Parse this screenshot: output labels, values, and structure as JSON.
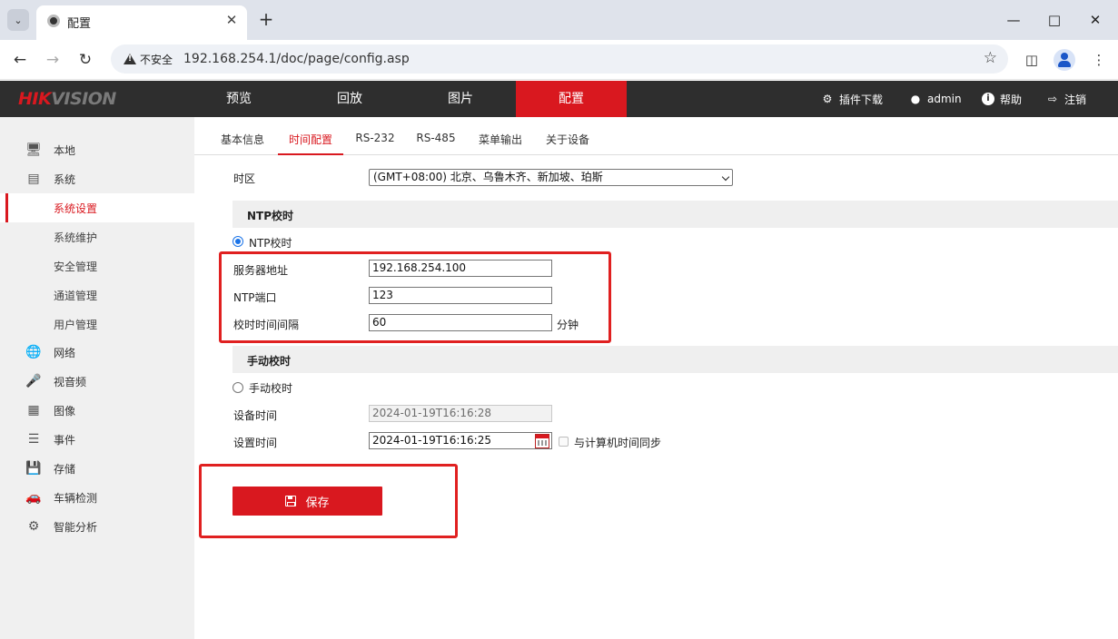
{
  "browser": {
    "tab_title": "配置",
    "security_label": "不安全",
    "url": "192.168.254.1/doc/page/config.asp"
  },
  "header": {
    "logo_hik": "HIK",
    "logo_vision": "VISION",
    "nav": [
      "预览",
      "回放",
      "图片",
      "配置"
    ],
    "active_nav": "配置",
    "plugin_download": "插件下载",
    "user": "admin",
    "help": "帮助",
    "logout": "注销"
  },
  "sidebar": {
    "items": [
      {
        "label": "本地",
        "icon": "monitor-icon"
      },
      {
        "label": "系统",
        "icon": "system-icon"
      },
      {
        "label": "系统设置",
        "sub": true,
        "active": true
      },
      {
        "label": "系统维护",
        "sub": true
      },
      {
        "label": "安全管理",
        "sub": true
      },
      {
        "label": "通道管理",
        "sub": true
      },
      {
        "label": "用户管理",
        "sub": true
      },
      {
        "label": "网络",
        "icon": "globe-icon"
      },
      {
        "label": "视音频",
        "icon": "mic-icon"
      },
      {
        "label": "图像",
        "icon": "image-icon"
      },
      {
        "label": "事件",
        "icon": "event-icon"
      },
      {
        "label": "存储",
        "icon": "storage-icon"
      },
      {
        "label": "车辆检测",
        "icon": "car-icon"
      },
      {
        "label": "智能分析",
        "icon": "analysis-icon"
      }
    ]
  },
  "subtabs": [
    "基本信息",
    "时间配置",
    "RS-232",
    "RS-485",
    "菜单输出",
    "关于设备"
  ],
  "active_subtab": "时间配置",
  "form": {
    "timezone_label": "时区",
    "timezone_value": "(GMT+08:00) 北京、乌鲁木齐、新加坡、珀斯",
    "ntp_section": "NTP校时",
    "ntp_radio_label": "NTP校时",
    "server_label": "服务器地址",
    "server_value": "192.168.254.100",
    "port_label": "NTP端口",
    "port_value": "123",
    "interval_label": "校时时间间隔",
    "interval_value": "60",
    "interval_unit": "分钟",
    "manual_section": "手动校时",
    "manual_radio_label": "手动校时",
    "device_time_label": "设备时间",
    "device_time_value": "2024-01-19T16:16:28",
    "set_time_label": "设置时间",
    "set_time_value": "2024-01-19T16:16:25",
    "sync_pc_label": "与计算机时间同步",
    "save_label": "保存"
  },
  "colors": {
    "brand_red": "#d9181f",
    "header_bg": "#2e2e2e",
    "highlight": "#e02020"
  }
}
